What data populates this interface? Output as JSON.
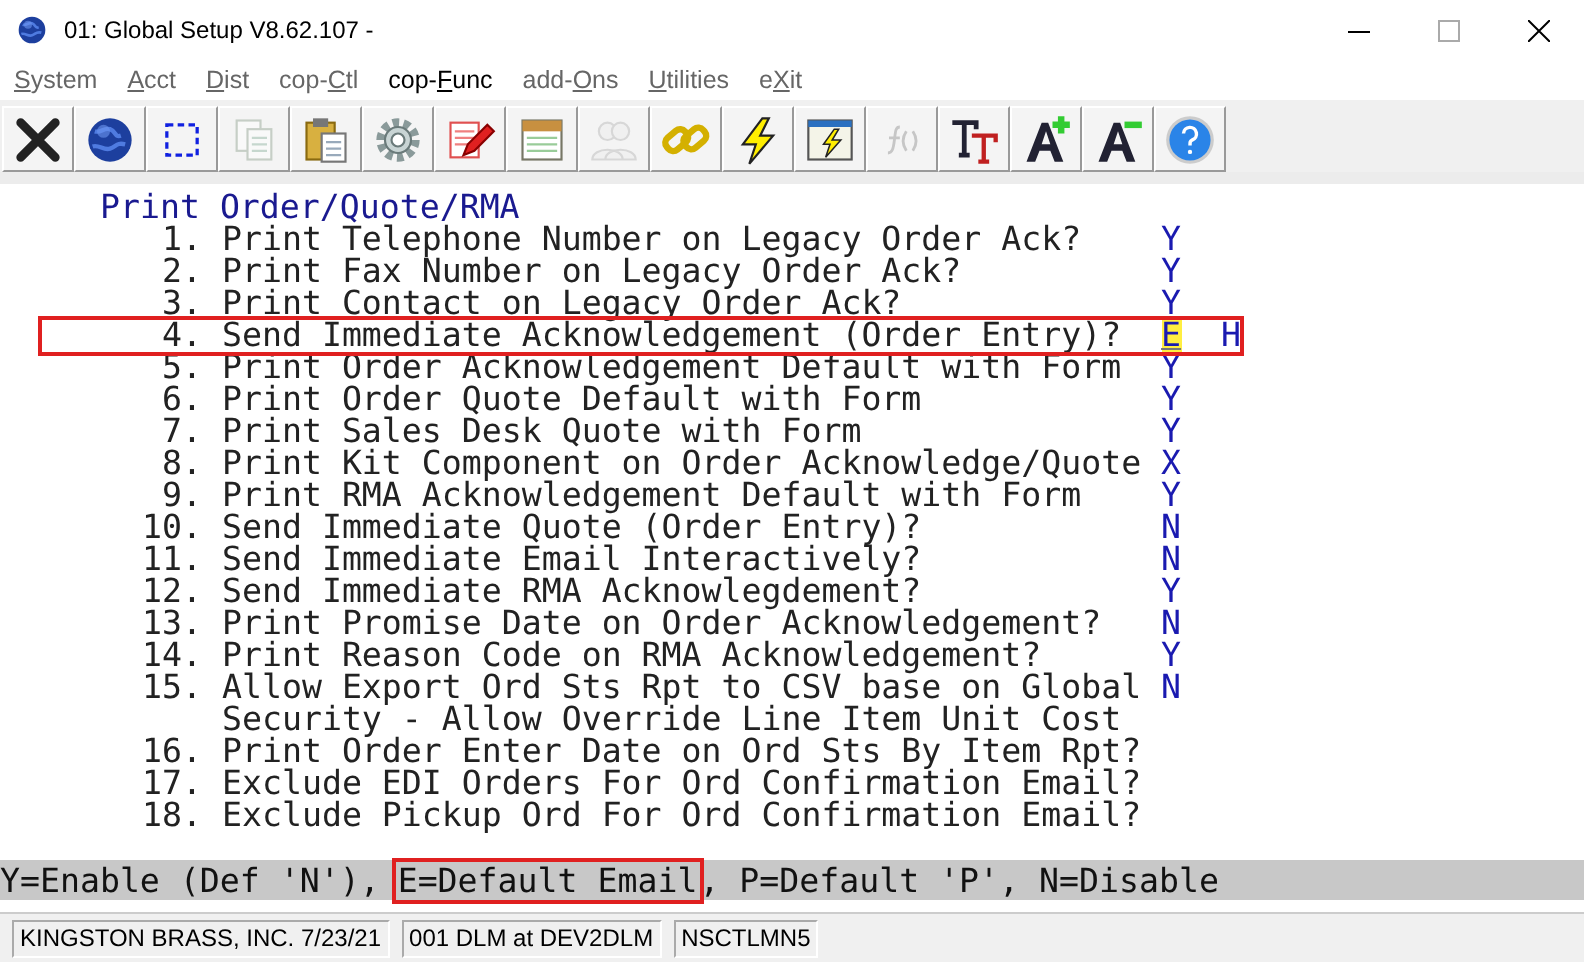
{
  "window": {
    "title": "01: Global Setup V8.62.107 -"
  },
  "menu": [
    {
      "key": "S",
      "after": "ystem",
      "selected": false
    },
    {
      "key": "A",
      "after": "cct",
      "selected": false
    },
    {
      "key": "D",
      "after": "ist",
      "selected": false
    },
    {
      "before": "cop-",
      "key": "C",
      "after": "tl",
      "selected": false
    },
    {
      "before": "cop-",
      "key": "F",
      "after": "unc",
      "selected": true
    },
    {
      "before": "add-",
      "key": "O",
      "after": "ns",
      "selected": false
    },
    {
      "key": "U",
      "after": "tilities",
      "selected": false
    },
    {
      "before": "e",
      "key": "X",
      "after": "it",
      "selected": false
    }
  ],
  "toolbar": [
    {
      "kind": "close",
      "disabled": false
    },
    {
      "kind": "globe",
      "disabled": false
    },
    {
      "kind": "select",
      "disabled": false
    },
    {
      "kind": "copy",
      "disabled": true
    },
    {
      "kind": "paste",
      "disabled": false
    },
    {
      "kind": "gear",
      "disabled": false
    },
    {
      "kind": "edit",
      "disabled": false
    },
    {
      "kind": "notes",
      "disabled": false
    },
    {
      "kind": "users",
      "disabled": true
    },
    {
      "kind": "link",
      "disabled": false
    },
    {
      "kind": "lightning",
      "disabled": false
    },
    {
      "kind": "form",
      "disabled": false
    },
    {
      "kind": "function",
      "disabled": true
    },
    {
      "kind": "text",
      "disabled": false
    },
    {
      "kind": "larger",
      "disabled": false
    },
    {
      "kind": "smaller",
      "disabled": false
    },
    {
      "kind": "help",
      "disabled": false
    }
  ],
  "screen": {
    "heading": "Print Order/Quote/RMA",
    "rows": [
      {
        "number": "1.",
        "label": "Print Telephone Number on Legacy Order Ack?",
        "value": "Y",
        "highlighted": false
      },
      {
        "number": "2.",
        "label": "Print Fax Number on Legacy Order Ack?",
        "value": "Y",
        "highlighted": false
      },
      {
        "number": "3.",
        "label": "Print Contact on Legacy Order Ack?",
        "value": "Y",
        "highlighted": false
      },
      {
        "number": "4.",
        "label": "Send Immediate Acknowledgement (Order Entry)?",
        "value": "E",
        "highlighted": true,
        "note": "H"
      },
      {
        "number": "5.",
        "label": "Print Order Acknowledgement Default with Form",
        "value": "Y",
        "highlighted": false
      },
      {
        "number": "6.",
        "label": "Print Order Quote Default with Form",
        "value": "Y",
        "highlighted": false
      },
      {
        "number": "7.",
        "label": "Print Sales Desk Quote with Form",
        "value": "Y",
        "highlighted": false
      },
      {
        "number": "8.",
        "label": "Print Kit Component on Order Acknowledge/Quote",
        "value": "X",
        "highlighted": false
      },
      {
        "number": "9.",
        "label": "Print RMA Acknowledgement Default with Form",
        "value": "Y",
        "highlighted": false
      },
      {
        "number": "10.",
        "label": "Send Immediate Quote (Order Entry)?",
        "value": "N",
        "highlighted": false
      },
      {
        "number": "11.",
        "label": "Send Immediate Email Interactively?",
        "value": "N",
        "highlighted": false
      },
      {
        "number": "12.",
        "label": "Send Immediate RMA Acknowlegdement?",
        "value": "Y",
        "highlighted": false
      },
      {
        "number": "13.",
        "label": "Print Promise Date on Order Acknowledgement?",
        "value": "N",
        "highlighted": false
      },
      {
        "number": "14.",
        "label": "Print Reason Code on RMA Acknowledgement?",
        "value": "Y",
        "highlighted": false
      },
      {
        "number": "15.",
        "label": "Allow Export Ord Sts Rpt to CSV base on Global Security - Allow Override Line Item Unit Cost",
        "value": "N",
        "highlighted": false
      },
      {
        "number": "16.",
        "label": "Print Order Enter Date on Ord Sts By Item Rpt?",
        "highlighted": false
      },
      {
        "number": "17.",
        "label": "Exclude EDI Orders For Ord Confirmation Email?",
        "highlighted": false
      },
      {
        "number": "18.",
        "label": "Exclude Pickup Ord For Ord Confirmation Email?",
        "highlighted": false
      }
    ]
  },
  "hint_bar": [
    {
      "text": "Y=Enable (Def 'N'),",
      "highlighted": false
    },
    {
      "text": "E=Default Email",
      "highlighted": true
    },
    {
      "text": ", P=Default 'P', N=Disable",
      "highlighted": false
    }
  ],
  "status_bar": [
    "KINGSTON BRASS, INC. 7/23/21",
    "001 DLM at DEV2DLM",
    "NSCTLMN5"
  ]
}
